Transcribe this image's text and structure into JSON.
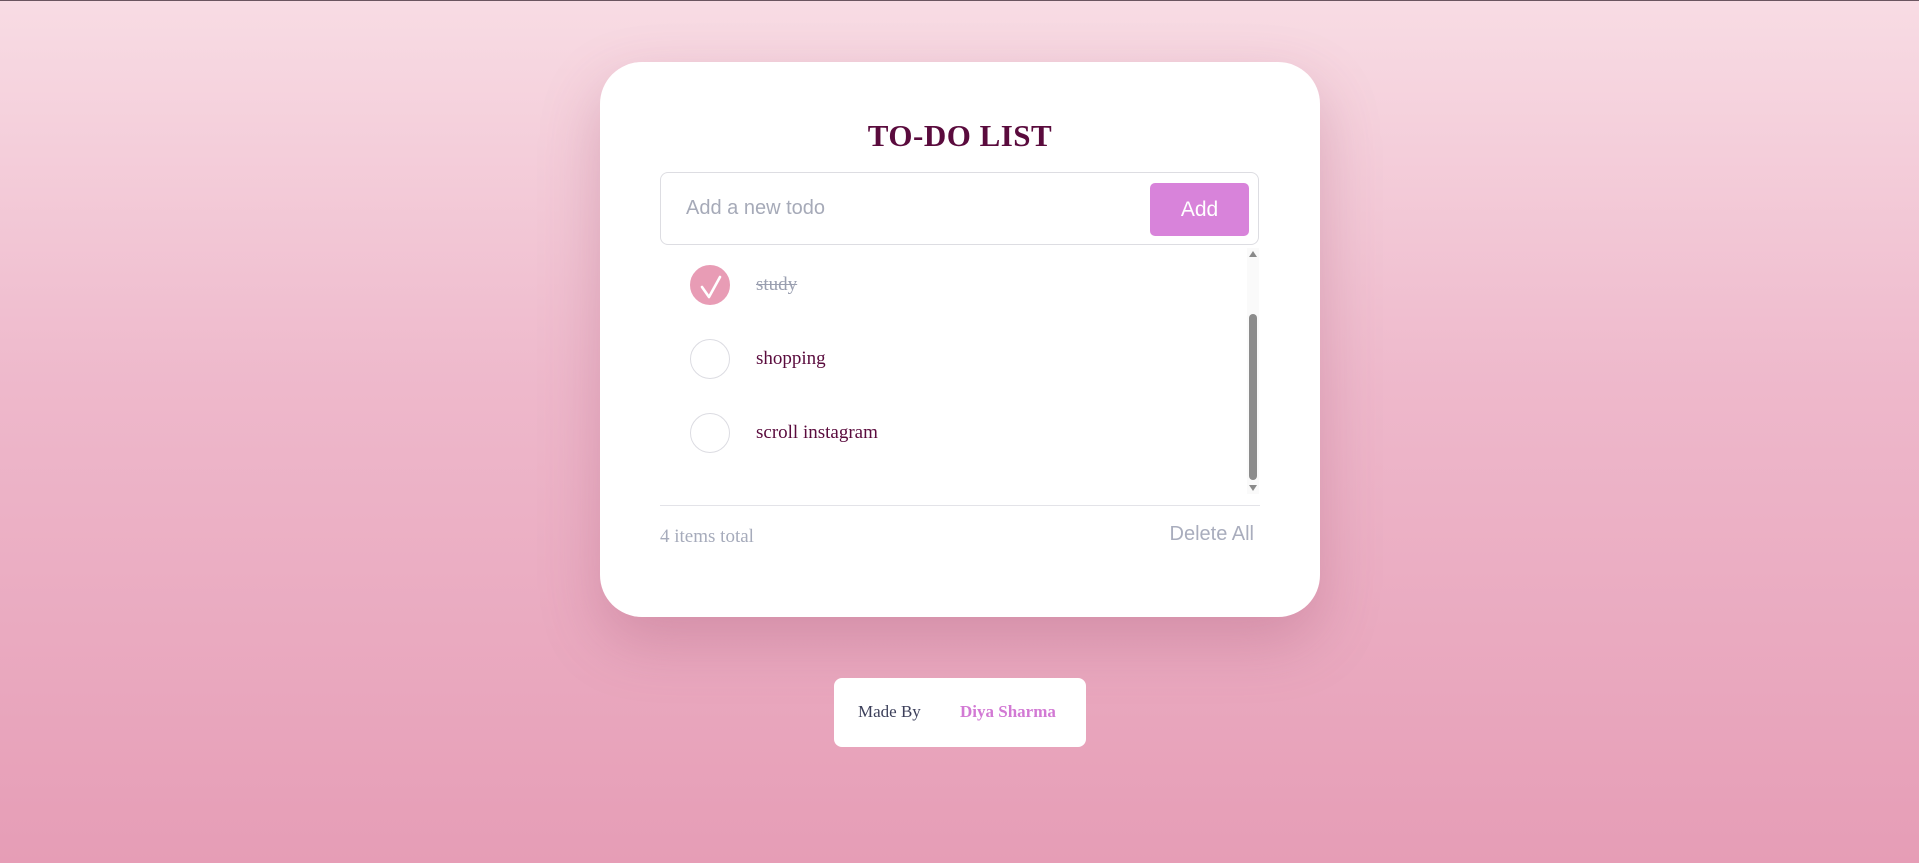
{
  "app": {
    "title": "TO-DO LIST"
  },
  "input": {
    "placeholder": "Add a new todo",
    "value": "",
    "add_label": "Add"
  },
  "todos": [
    {
      "text": "study",
      "completed": true
    },
    {
      "text": "shopping",
      "completed": false
    },
    {
      "text": "scroll instagram",
      "completed": false
    }
  ],
  "footer_bar": {
    "count_text": "4 items total",
    "delete_all_label": "Delete All"
  },
  "credit": {
    "made_by_label": "Made By",
    "author": "Diya Sharma"
  },
  "colors": {
    "title": "#5a0b3d",
    "accent_button": "#d883da",
    "checked": "#e89cb5",
    "author": "#d279d4",
    "background_top": "#f8dce4",
    "background_bottom": "#e69db6"
  },
  "icons": {
    "checkmark": "check-icon"
  }
}
